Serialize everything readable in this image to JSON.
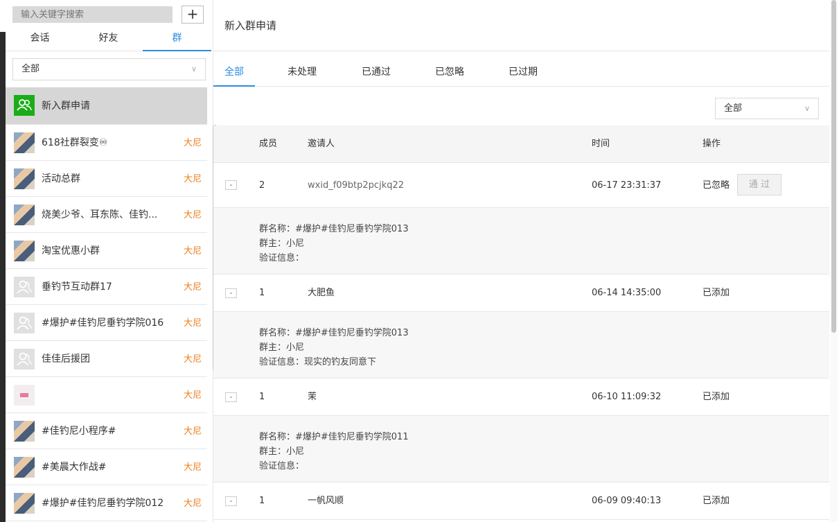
{
  "sidebar": {
    "search_placeholder": "输入关键字搜索",
    "add_label": "+",
    "tabs": [
      "会话",
      "好友",
      "群"
    ],
    "filter_value": "全部",
    "groups": [
      {
        "name": "新入群申请",
        "owner": ""
      },
      {
        "name": "618社群裂变♾",
        "owner": "大尼"
      },
      {
        "name": "活动总群",
        "owner": "大尼"
      },
      {
        "name": "烧美少爷、耳东陈、佳钓...",
        "owner": "大尼"
      },
      {
        "name": "淘宝优惠小群",
        "owner": "大尼"
      },
      {
        "name": "垂钓节互动群17",
        "owner": "大尼"
      },
      {
        "name": "#爆护#佳钓尼垂钓学院016",
        "owner": "大尼"
      },
      {
        "name": "佳佳后援团",
        "owner": "大尼"
      },
      {
        "name": "",
        "owner": "大尼"
      },
      {
        "name": "#佳钓尼小程序#",
        "owner": "大尼"
      },
      {
        "name": "#美晨大作战#",
        "owner": "大尼"
      },
      {
        "name": "#爆护#佳钓尼垂钓学院012",
        "owner": "大尼"
      }
    ]
  },
  "main": {
    "title": "新入群申请",
    "status_tabs": [
      "全部",
      "未处理",
      "已通过",
      "已忽略",
      "已过期"
    ],
    "filter_value": "全部",
    "columns": [
      "成员",
      "邀请人",
      "时间",
      "操作"
    ],
    "requests": [
      {
        "toggle": "-",
        "members": "2",
        "inviter": "wxid_f09btp2pcjkq22",
        "time": "06-17 23:31:37",
        "status": "已忽略",
        "action": "通 过",
        "details": [
          "群名称：#爆护#佳钓尼垂钓学院013",
          "群主：小尼",
          "验证信息："
        ]
      },
      {
        "toggle": "-",
        "members": "1",
        "inviter": "大肥鱼",
        "time": "06-14 14:35:00",
        "status": "已添加",
        "details": [
          "群名称：#爆护#佳钓尼垂钓学院013",
          "群主：小尼",
          "验证信息：现实的钓友同意下"
        ]
      },
      {
        "toggle": "-",
        "members": "1",
        "inviter": "茉",
        "time": "06-10 11:09:32",
        "status": "已添加",
        "details": [
          "群名称：#爆护#佳钓尼垂钓学院011",
          "群主：小尼",
          "验证信息："
        ]
      },
      {
        "toggle": "-",
        "members": "1",
        "inviter": "一帆风顺",
        "time": "06-09 09:40:13",
        "status": "已添加",
        "details": []
      }
    ]
  }
}
